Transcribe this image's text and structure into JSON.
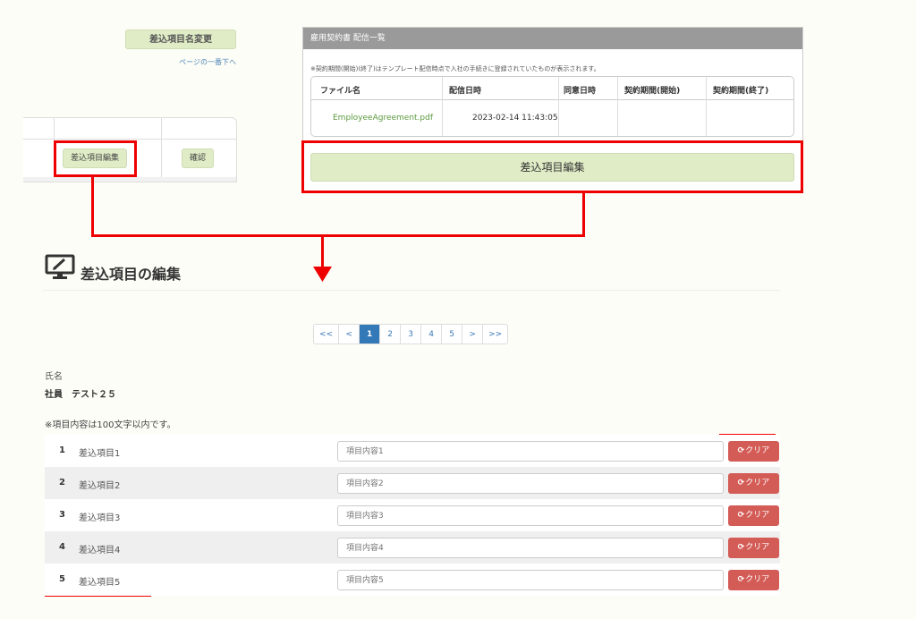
{
  "top_left": {
    "rename_button": "差込項目名変更",
    "page_bottom_link": "ページの一番下へ",
    "row_edit_button": "差込項目編集",
    "row_confirm_button": "確認"
  },
  "panel": {
    "title": "雇用契約書 配信一覧",
    "note": "※契約期間(開始)(終了)はテンプレート配信時点で入社の手続きに登録されていたものが表示されます。",
    "columns": [
      "ファイル名",
      "配信日時",
      "同意日時",
      "契約期間(開始)",
      "契約期間(終了)"
    ],
    "row": {
      "file": "EmployeeAgreement.pdf",
      "sent": "2023-02-14 11:43:05",
      "agreed": "",
      "start": "",
      "end": ""
    },
    "edit_button": "差込項目編集"
  },
  "edit_section": {
    "title": "差込項目の編集",
    "pagination": [
      "<<",
      "<",
      "1",
      "2",
      "3",
      "4",
      "5",
      ">",
      ">>"
    ],
    "active_page": "1",
    "name_label": "氏名",
    "name_value": "社員　テスト２５",
    "limit_note": "※項目内容は100文字以内です。",
    "clear_label": "クリア",
    "items": [
      {
        "num": "1",
        "name": "差込項目1",
        "placeholder": "項目内容1"
      },
      {
        "num": "2",
        "name": "差込項目2",
        "placeholder": "項目内容2"
      },
      {
        "num": "3",
        "name": "差込項目3",
        "placeholder": "項目内容3"
      },
      {
        "num": "4",
        "name": "差込項目4",
        "placeholder": "項目内容4"
      },
      {
        "num": "5",
        "name": "差込項目5",
        "placeholder": "項目内容5"
      }
    ]
  },
  "colors": {
    "accent_green": "#dfecc6",
    "highlight_red": "#e00000",
    "clear_red": "#d45c57",
    "page_blue": "#3378b7"
  }
}
